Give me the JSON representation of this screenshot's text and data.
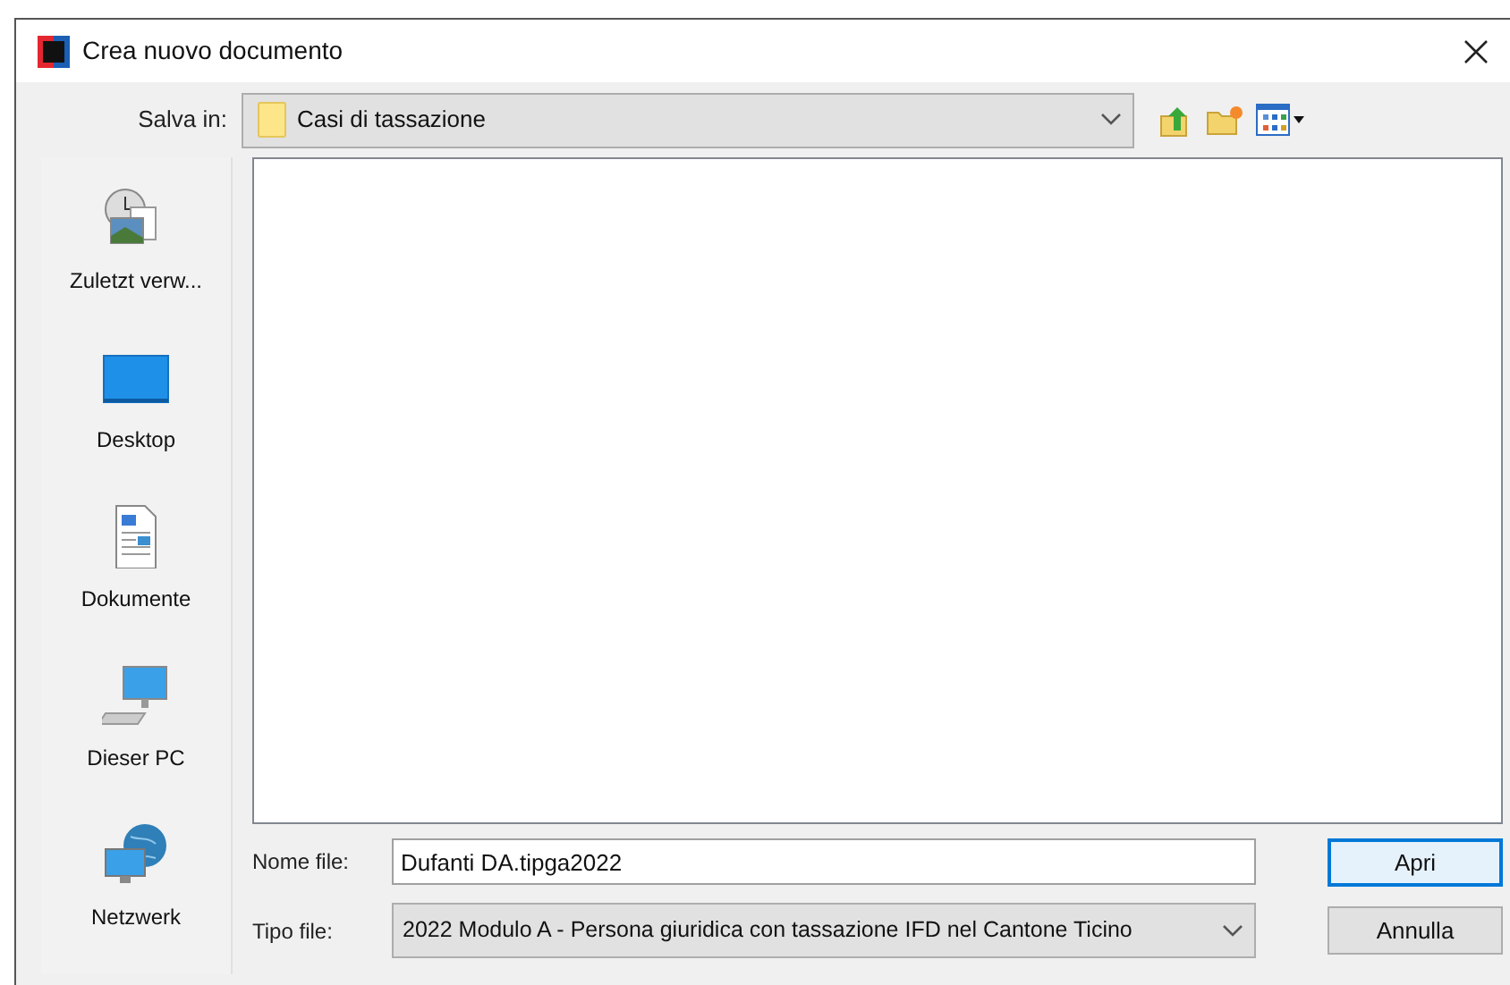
{
  "window": {
    "title": "Crea nuovo documento"
  },
  "save_in": {
    "label": "Salva in:",
    "value": "Casi di tassazione"
  },
  "places": [
    {
      "kind": "recent",
      "label": "Zuletzt verw..."
    },
    {
      "kind": "desktop",
      "label": "Desktop"
    },
    {
      "kind": "documents",
      "label": "Dokumente"
    },
    {
      "kind": "computer",
      "label": "Dieser PC"
    },
    {
      "kind": "network",
      "label": "Netzwerk"
    }
  ],
  "file_name": {
    "label": "Nome file:",
    "value": "Dufanti DA.tipga2022"
  },
  "file_type": {
    "label": "Tipo file:",
    "value": "2022 Modulo A - Persona giuridica con tassazione IFD nel Cantone Ticino"
  },
  "buttons": [
    {
      "label": "Apri",
      "default": true
    },
    {
      "label": "Annulla",
      "default": false
    }
  ]
}
